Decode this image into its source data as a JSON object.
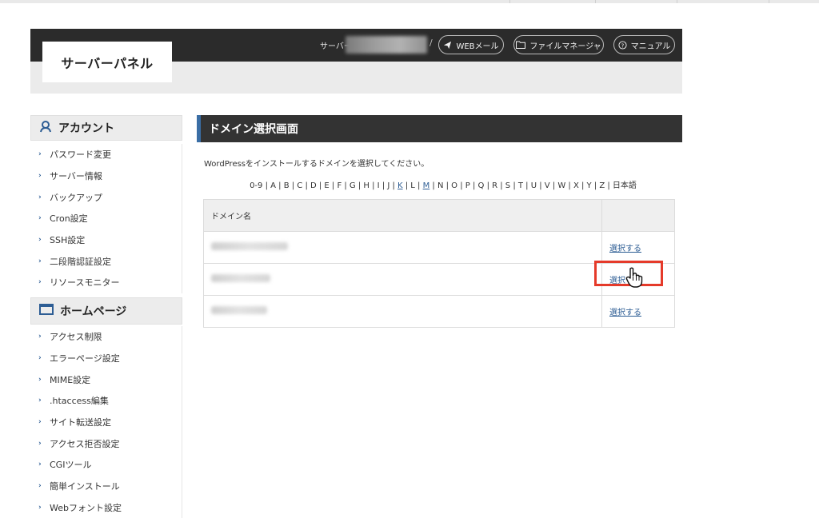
{
  "header": {
    "logo": "サーバーパネル",
    "server_label": "サーバー",
    "server_sep": "/",
    "buttons": [
      {
        "label": "WEBメール",
        "icon": "paper-plane-icon"
      },
      {
        "label": "ファイルマネージャ",
        "icon": "folder-icon"
      },
      {
        "label": "マニュアル",
        "icon": "question-circle-icon"
      }
    ]
  },
  "sidebar": {
    "account": {
      "title": "アカウント",
      "icon": "user-icon",
      "items": [
        "パスワード変更",
        "サーバー情報",
        "バックアップ",
        "Cron設定",
        "SSH設定",
        "二段階認証設定",
        "リソースモニター"
      ]
    },
    "homepage": {
      "title": "ホームページ",
      "icon": "window-icon",
      "items": [
        "アクセス制限",
        "エラーページ設定",
        "MIME設定",
        ".htaccess編集",
        "サイト転送設定",
        "アクセス拒否設定",
        "CGIツール",
        "簡単インストール",
        "Webフォント設定"
      ]
    }
  },
  "main": {
    "title": "ドメイン選択画面",
    "intro": "WordPressをインストールするドメインを選択してください。",
    "alphabet": {
      "before": "0-9 | A | B | C | D | E | F | G | H | I | J | ",
      "k": "K",
      "mid": " | L | ",
      "m": "M",
      "after": " | N | O | P | Q | R | S | T | U | V | W | X | Y | Z | 日本語"
    },
    "table": {
      "header": "ドメイン名",
      "select_label": "選択する",
      "rows": 3
    }
  },
  "colors": {
    "header_dark": "#2b2b2b",
    "link": "#2d5d94",
    "accent_border": "#3a6ea5",
    "highlight": "#e53a2a"
  }
}
